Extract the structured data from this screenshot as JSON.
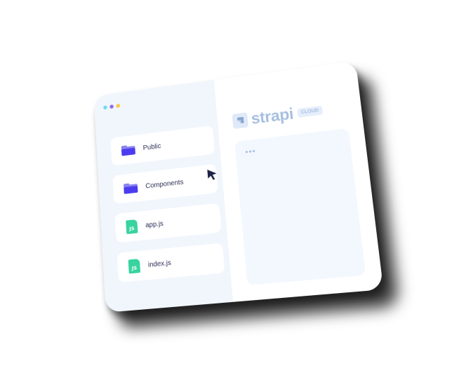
{
  "window": {
    "traffic_lights": [
      {
        "name": "cyan",
        "color": "#6fdcf0"
      },
      {
        "name": "purple",
        "color": "#8b6cf0"
      },
      {
        "name": "yellow",
        "color": "#f8c94c"
      }
    ]
  },
  "file_list": {
    "items": [
      {
        "label": "Public",
        "icon": "folder-icon"
      },
      {
        "label": "Components",
        "icon": "folder-icon"
      },
      {
        "label": "app.js",
        "icon": "js-file-icon",
        "badge": "JS"
      },
      {
        "label": "index.js",
        "icon": "js-file-icon",
        "badge": "JS"
      }
    ]
  },
  "brand": {
    "name": "strapi",
    "badge": "CLOUD",
    "logo_icon": "strapi-logo-icon"
  },
  "preview": {
    "menu": "•••"
  },
  "colors": {
    "accent": "#4c3cf0",
    "js": "#38d39f",
    "brand": "#a7bfe0",
    "pane": "#f1f6fd"
  }
}
